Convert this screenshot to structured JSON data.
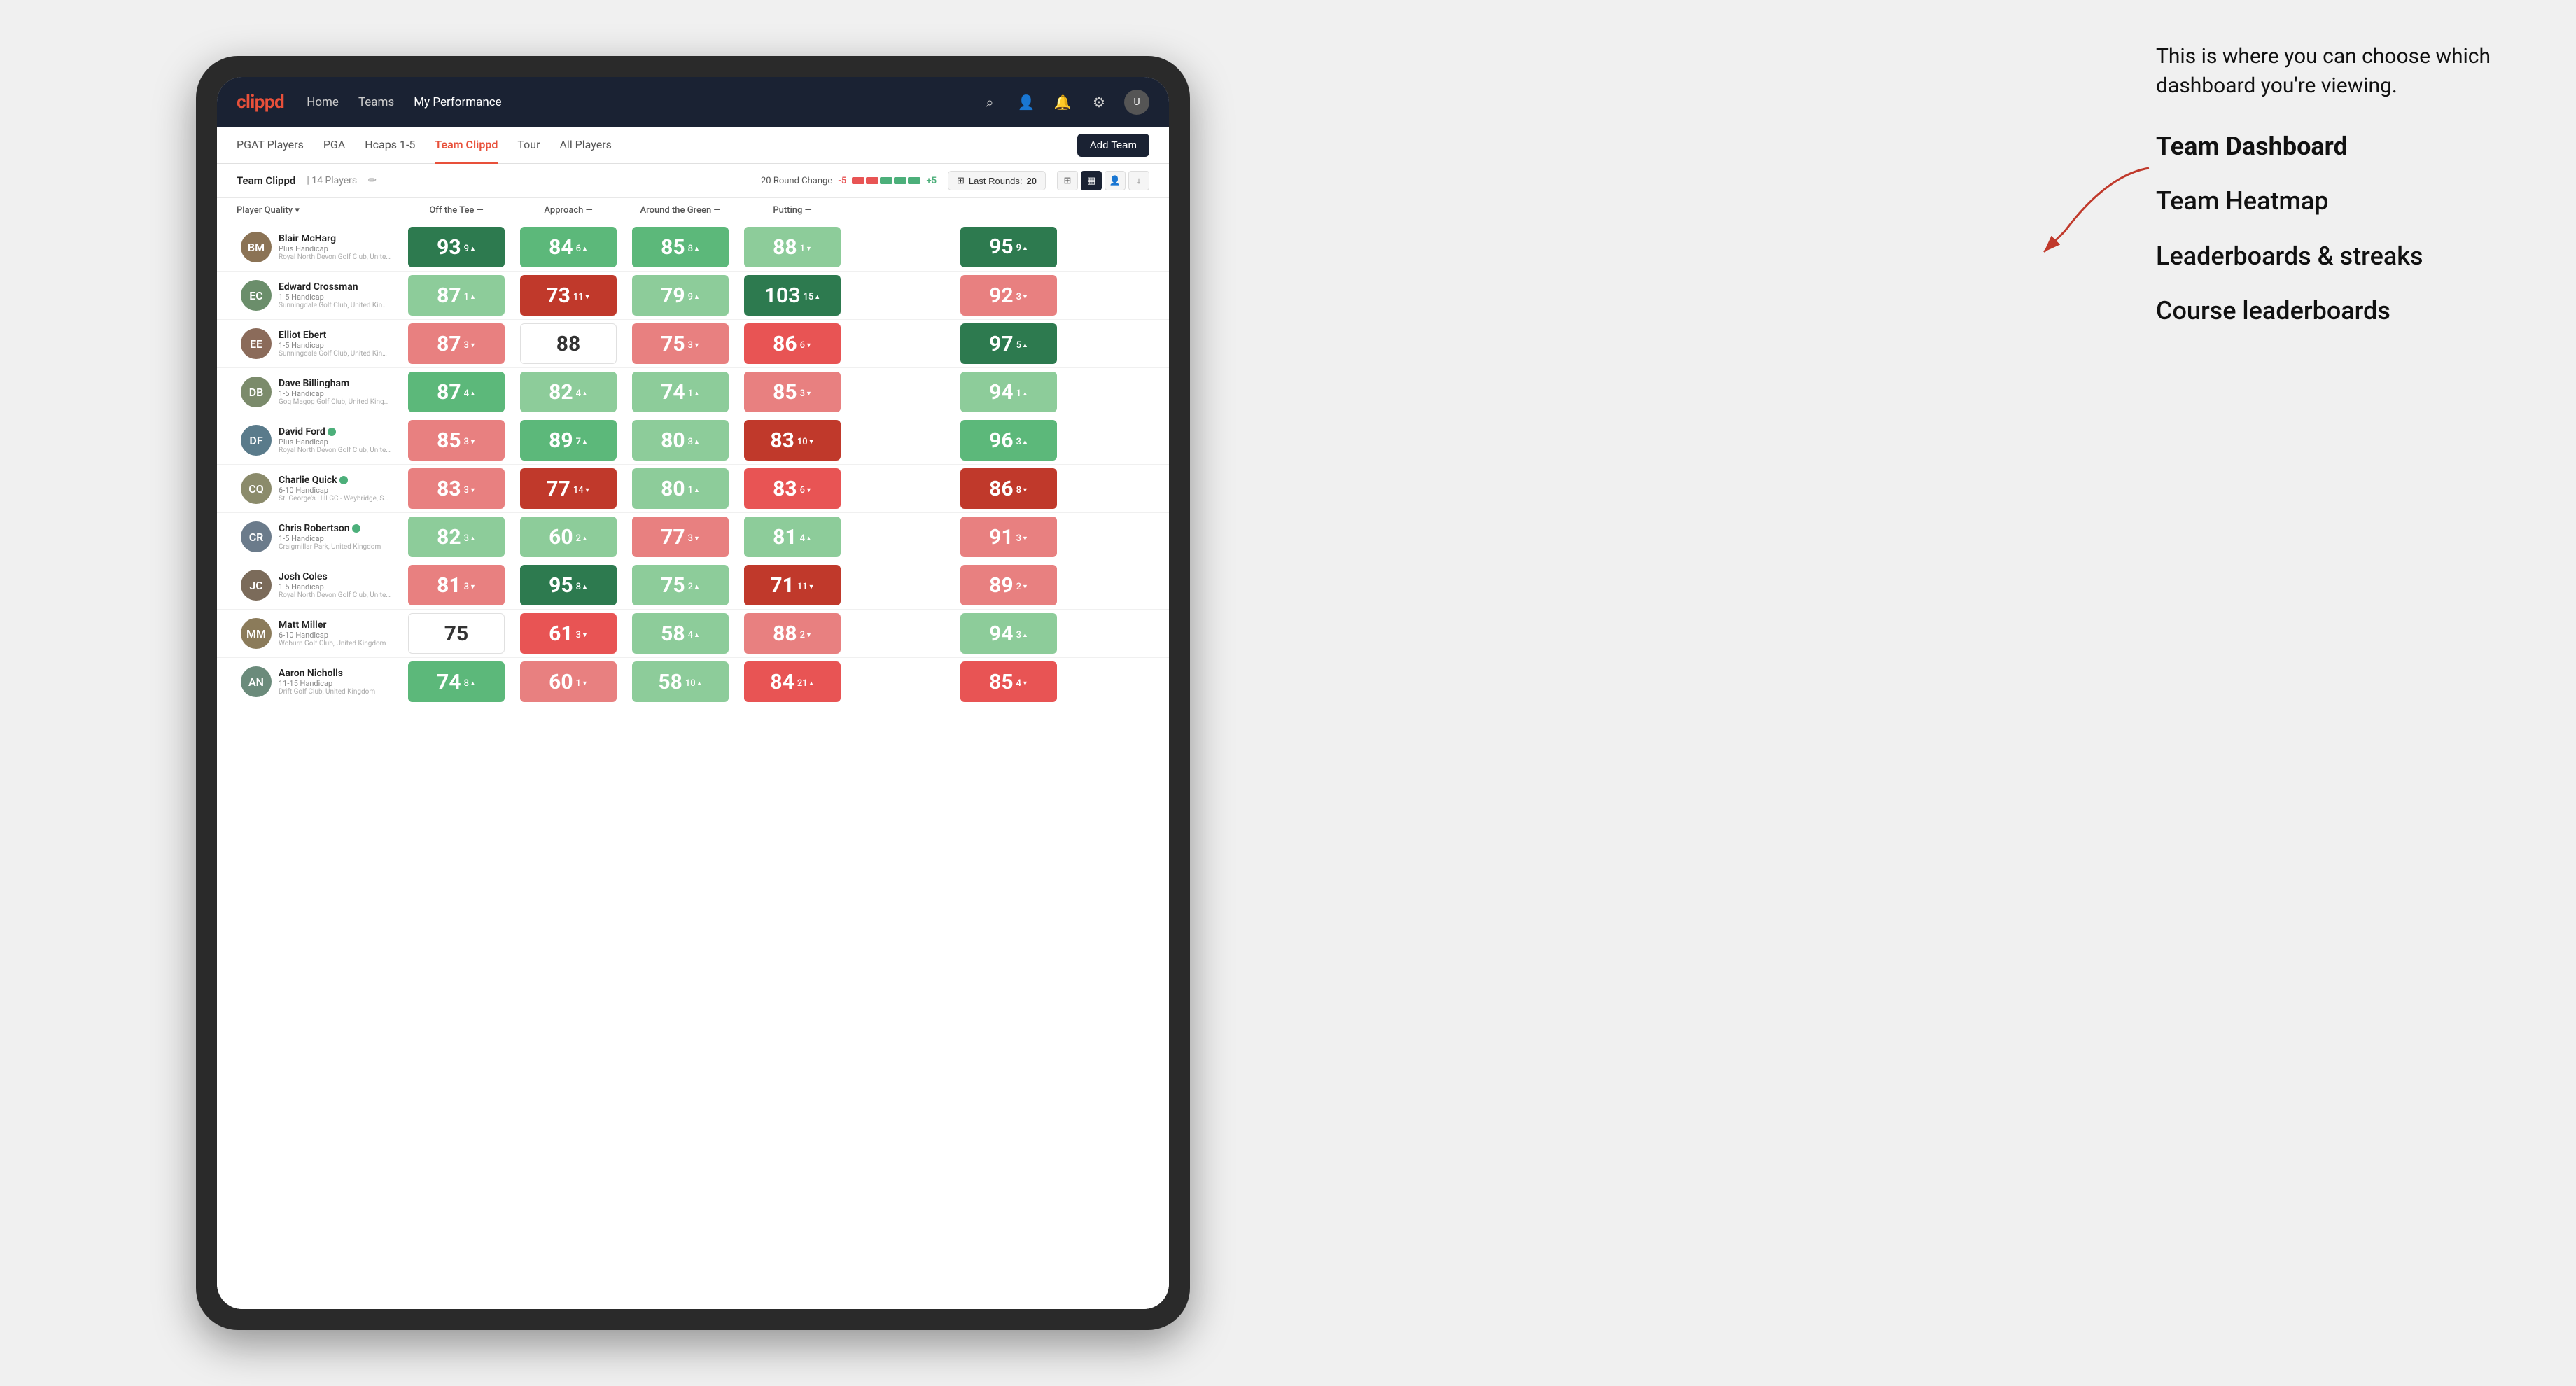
{
  "annotation": {
    "intro_text": "This is where you can choose which dashboard you're viewing.",
    "menu_items": [
      {
        "label": "Team Dashboard",
        "active": true
      },
      {
        "label": "Team Heatmap",
        "active": false
      },
      {
        "label": "Leaderboards & streaks",
        "active": false
      },
      {
        "label": "Course leaderboards",
        "active": false
      }
    ]
  },
  "nav": {
    "logo": "clippd",
    "links": [
      {
        "label": "Home",
        "active": false
      },
      {
        "label": "Teams",
        "active": false
      },
      {
        "label": "My Performance",
        "active": true
      }
    ],
    "icons": [
      "search",
      "person",
      "bell",
      "settings",
      "user"
    ]
  },
  "sub_nav": {
    "tabs": [
      {
        "label": "PGAT Players",
        "active": false
      },
      {
        "label": "PGA",
        "active": false
      },
      {
        "label": "Hcaps 1-5",
        "active": false
      },
      {
        "label": "Team Clippd",
        "active": true
      },
      {
        "label": "Tour",
        "active": false
      },
      {
        "label": "All Players",
        "active": false
      }
    ],
    "add_team_label": "Add Team"
  },
  "team_header": {
    "team_name": "Team Clippd",
    "separator": "|",
    "player_count": "14 Players",
    "round_change_label": "20 Round Change",
    "change_neg": "-5",
    "change_pos": "+5",
    "last_rounds_label": "Last Rounds:",
    "last_rounds_value": "20",
    "view_labels": [
      "grid",
      "heatmap",
      "list",
      "download"
    ]
  },
  "table": {
    "columns": [
      {
        "label": "Player Quality",
        "key": "player_quality"
      },
      {
        "label": "Off the Tee",
        "key": "off_tee"
      },
      {
        "label": "Approach",
        "key": "approach"
      },
      {
        "label": "Around the Green",
        "key": "around_green"
      },
      {
        "label": "Putting",
        "key": "putting"
      }
    ],
    "players": [
      {
        "name": "Blair McHarg",
        "handicap": "Plus Handicap",
        "club": "Royal North Devon Golf Club, United Kingdom",
        "avatar_color": "#8B7355",
        "initials": "BM",
        "player_quality": {
          "val": 93,
          "delta": "9",
          "dir": "up",
          "color": "green-strong"
        },
        "off_tee": {
          "val": 84,
          "delta": "6",
          "dir": "up",
          "color": "green-med"
        },
        "approach": {
          "val": 85,
          "delta": "8",
          "dir": "up",
          "color": "green-med"
        },
        "around_green": {
          "val": 88,
          "delta": "1",
          "dir": "down",
          "color": "green-light"
        },
        "putting": {
          "val": 95,
          "delta": "9",
          "dir": "up",
          "color": "green-strong"
        }
      },
      {
        "name": "Edward Crossman",
        "handicap": "1-5 Handicap",
        "club": "Sunningdale Golf Club, United Kingdom",
        "avatar_color": "#6B8E6B",
        "initials": "EC",
        "player_quality": {
          "val": 87,
          "delta": "1",
          "dir": "up",
          "color": "green-light"
        },
        "off_tee": {
          "val": 73,
          "delta": "11",
          "dir": "down",
          "color": "red-strong"
        },
        "approach": {
          "val": 79,
          "delta": "9",
          "dir": "up",
          "color": "green-light"
        },
        "around_green": {
          "val": 103,
          "delta": "15",
          "dir": "up",
          "color": "green-strong"
        },
        "putting": {
          "val": 92,
          "delta": "3",
          "dir": "down",
          "color": "red-light"
        }
      },
      {
        "name": "Elliot Ebert",
        "handicap": "1-5 Handicap",
        "club": "Sunningdale Golf Club, United Kingdom",
        "avatar_color": "#8B6B5A",
        "initials": "EE",
        "player_quality": {
          "val": 87,
          "delta": "3",
          "dir": "down",
          "color": "red-light"
        },
        "off_tee": {
          "val": 88,
          "delta": "",
          "dir": "",
          "color": "white"
        },
        "approach": {
          "val": 75,
          "delta": "3",
          "dir": "down",
          "color": "red-light"
        },
        "around_green": {
          "val": 86,
          "delta": "6",
          "dir": "down",
          "color": "red-med"
        },
        "putting": {
          "val": 97,
          "delta": "5",
          "dir": "up",
          "color": "green-strong"
        }
      },
      {
        "name": "Dave Billingham",
        "handicap": "1-5 Handicap",
        "club": "Gog Magog Golf Club, United Kingdom",
        "avatar_color": "#7B8B6B",
        "initials": "DB",
        "player_quality": {
          "val": 87,
          "delta": "4",
          "dir": "up",
          "color": "green-med"
        },
        "off_tee": {
          "val": 82,
          "delta": "4",
          "dir": "up",
          "color": "green-light"
        },
        "approach": {
          "val": 74,
          "delta": "1",
          "dir": "up",
          "color": "green-light"
        },
        "around_green": {
          "val": 85,
          "delta": "3",
          "dir": "down",
          "color": "red-light"
        },
        "putting": {
          "val": 94,
          "delta": "1",
          "dir": "up",
          "color": "green-light"
        }
      },
      {
        "name": "David Ford",
        "handicap": "Plus Handicap",
        "club": "Royal North Devon Golf Club, United Kingdom",
        "avatar_color": "#5A7B8B",
        "initials": "DF",
        "verified": true,
        "player_quality": {
          "val": 85,
          "delta": "3",
          "dir": "down",
          "color": "red-light"
        },
        "off_tee": {
          "val": 89,
          "delta": "7",
          "dir": "up",
          "color": "green-med"
        },
        "approach": {
          "val": 80,
          "delta": "3",
          "dir": "up",
          "color": "green-light"
        },
        "around_green": {
          "val": 83,
          "delta": "10",
          "dir": "down",
          "color": "red-strong"
        },
        "putting": {
          "val": 96,
          "delta": "3",
          "dir": "up",
          "color": "green-med"
        }
      },
      {
        "name": "Charlie Quick",
        "handicap": "6-10 Handicap",
        "club": "St. George's Hill GC - Weybridge, Surrey, Uni...",
        "avatar_color": "#8B8B6B",
        "initials": "CQ",
        "verified": true,
        "player_quality": {
          "val": 83,
          "delta": "3",
          "dir": "down",
          "color": "red-light"
        },
        "off_tee": {
          "val": 77,
          "delta": "14",
          "dir": "down",
          "color": "red-strong"
        },
        "approach": {
          "val": 80,
          "delta": "1",
          "dir": "up",
          "color": "green-light"
        },
        "around_green": {
          "val": 83,
          "delta": "6",
          "dir": "down",
          "color": "red-med"
        },
        "putting": {
          "val": 86,
          "delta": "8",
          "dir": "down",
          "color": "red-strong"
        }
      },
      {
        "name": "Chris Robertson",
        "handicap": "1-5 Handicap",
        "club": "Craigmillar Park, United Kingdom",
        "avatar_color": "#6B7B8B",
        "initials": "CR",
        "verified": true,
        "player_quality": {
          "val": 82,
          "delta": "3",
          "dir": "up",
          "color": "green-light"
        },
        "off_tee": {
          "val": 60,
          "delta": "2",
          "dir": "up",
          "color": "green-light"
        },
        "approach": {
          "val": 77,
          "delta": "3",
          "dir": "down",
          "color": "red-light"
        },
        "around_green": {
          "val": 81,
          "delta": "4",
          "dir": "up",
          "color": "green-light"
        },
        "putting": {
          "val": 91,
          "delta": "3",
          "dir": "down",
          "color": "red-light"
        }
      },
      {
        "name": "Josh Coles",
        "handicap": "1-5 Handicap",
        "club": "Royal North Devon Golf Club, United Kingdom",
        "avatar_color": "#7B6B5A",
        "initials": "JC",
        "player_quality": {
          "val": 81,
          "delta": "3",
          "dir": "down",
          "color": "red-light"
        },
        "off_tee": {
          "val": 95,
          "delta": "8",
          "dir": "up",
          "color": "green-strong"
        },
        "approach": {
          "val": 75,
          "delta": "2",
          "dir": "up",
          "color": "green-light"
        },
        "around_green": {
          "val": 71,
          "delta": "11",
          "dir": "down",
          "color": "red-strong"
        },
        "putting": {
          "val": 89,
          "delta": "2",
          "dir": "down",
          "color": "red-light"
        }
      },
      {
        "name": "Matt Miller",
        "handicap": "6-10 Handicap",
        "club": "Woburn Golf Club, United Kingdom",
        "avatar_color": "#8B7B5A",
        "initials": "MM",
        "player_quality": {
          "val": 75,
          "delta": "",
          "dir": "",
          "color": "white"
        },
        "off_tee": {
          "val": 61,
          "delta": "3",
          "dir": "down",
          "color": "red-med"
        },
        "approach": {
          "val": 58,
          "delta": "4",
          "dir": "up",
          "color": "green-light"
        },
        "around_green": {
          "val": 88,
          "delta": "2",
          "dir": "down",
          "color": "red-light"
        },
        "putting": {
          "val": 94,
          "delta": "3",
          "dir": "up",
          "color": "green-light"
        }
      },
      {
        "name": "Aaron Nicholls",
        "handicap": "11-15 Handicap",
        "club": "Drift Golf Club, United Kingdom",
        "avatar_color": "#6B8B7B",
        "initials": "AN",
        "player_quality": {
          "val": 74,
          "delta": "8",
          "dir": "up",
          "color": "green-med"
        },
        "off_tee": {
          "val": 60,
          "delta": "1",
          "dir": "down",
          "color": "red-light"
        },
        "approach": {
          "val": 58,
          "delta": "10",
          "dir": "up",
          "color": "green-light"
        },
        "around_green": {
          "val": 84,
          "delta": "21",
          "dir": "up",
          "color": "red-med"
        },
        "putting": {
          "val": 85,
          "delta": "4",
          "dir": "down",
          "color": "red-med"
        }
      }
    ]
  }
}
